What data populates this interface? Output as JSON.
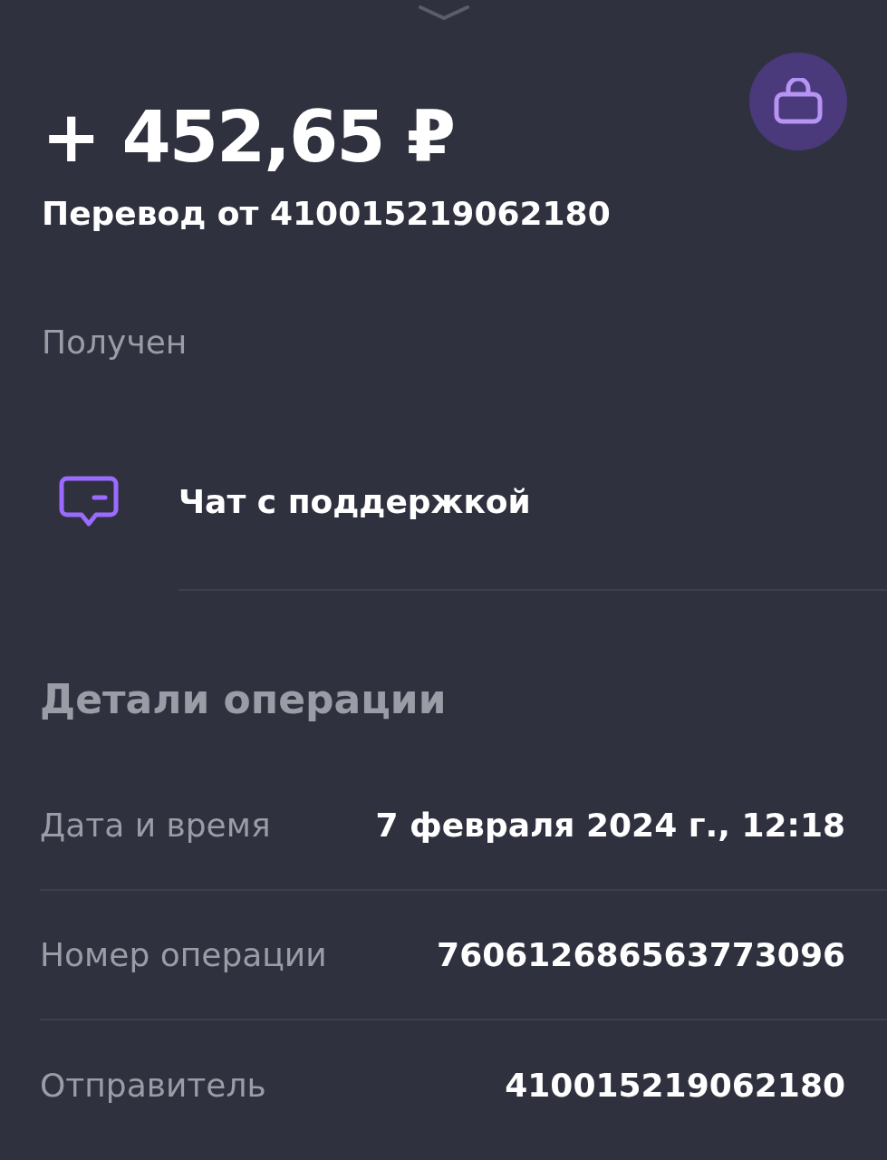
{
  "amount": "+ 452,65 ₽",
  "title": "Перевод от 410015219062180",
  "status": "Получен",
  "support": {
    "label": "Чат с поддержкой"
  },
  "details": {
    "title": "Детали операции",
    "rows": [
      {
        "label": "Дата и время",
        "value": "7 февраля 2024 г., 12:18"
      },
      {
        "label": "Номер операции",
        "value": "760612686563773096"
      },
      {
        "label": "Отправитель",
        "value": "410015219062180"
      }
    ]
  }
}
